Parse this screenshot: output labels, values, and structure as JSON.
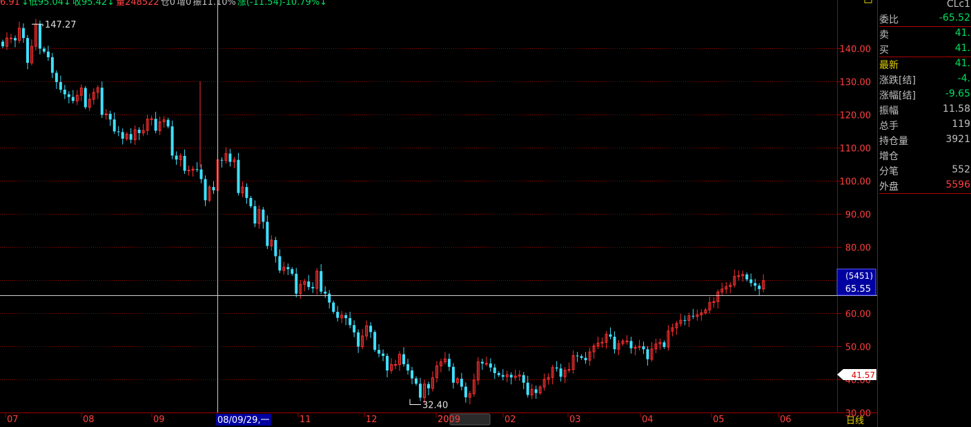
{
  "header": {
    "segments": [
      {
        "text": "6.91",
        "color": "#ff4040"
      },
      {
        "text": "↓低95.04↓",
        "color": "#00e060"
      },
      {
        "text": "收95.42↓",
        "color": "#00e060"
      },
      {
        "text": "量248522",
        "color": "#ff4040"
      },
      {
        "text": "仓0",
        "color": "#c0c0c0"
      },
      {
        "text": "增0",
        "color": "#c0c0c0"
      },
      {
        "text": "振11.10%",
        "color": "#c0c0c0"
      },
      {
        "text": "涨(-11.54)-10.79%↓",
        "color": "#00e060"
      }
    ]
  },
  "crosshair": {
    "date_label": "08/09/29,一",
    "price_value": "65.55",
    "price_extra": "(5451)"
  },
  "last_price_tag": "41.57",
  "timeframe_label": "日线",
  "annotations": {
    "high_label": "147.27",
    "low_label": "32.40"
  },
  "colors": {
    "up": "#ff3030",
    "down": "#40e0ff",
    "grid": "#a00000",
    "axis_text": "#ff4040",
    "month_text": "#ff4040"
  },
  "quote_panel": {
    "title": "CLc1",
    "rows": [
      {
        "label": "委比",
        "value": "-65.52",
        "value_color": "#00e060"
      },
      {
        "label": "卖",
        "value": "41.",
        "value_color": "#00e060"
      },
      {
        "label": "买",
        "value": "41.",
        "value_color": "#00e060"
      },
      {
        "label": "最新",
        "value": "41.",
        "value_color": "#00e060",
        "label_color": "#e6d200"
      },
      {
        "label": "涨跌[结]",
        "value": "-4.",
        "value_color": "#00e060"
      },
      {
        "label": "涨幅[结]",
        "value": "-9.65",
        "value_color": "#00e060"
      },
      {
        "label": "振幅",
        "value": "11.58",
        "value_color": "#c0c0c0"
      },
      {
        "label": "总手",
        "value": "119",
        "value_color": "#c0c0c0"
      },
      {
        "label": "持仓量",
        "value": "3921",
        "value_color": "#c0c0c0"
      },
      {
        "label": "增仓",
        "value": "",
        "value_color": "#c0c0c0"
      },
      {
        "label": "分笔",
        "value": "552",
        "value_color": "#c0c0c0"
      },
      {
        "label": "外盘",
        "value": "5596",
        "value_color": "#ff4040"
      }
    ]
  },
  "chart_data": {
    "type": "candlestick",
    "y_ticks": [
      30,
      40,
      50,
      60,
      70,
      80,
      90,
      100,
      110,
      120,
      130,
      140
    ],
    "y_tick_labels": [
      "30.00",
      "40.00",
      "50.00",
      "60.00",
      "70.00",
      "80.00",
      "90.00",
      "100.00",
      "110.00",
      "120.00",
      "130.00",
      "140.00"
    ],
    "ylim": [
      28,
      158
    ],
    "x_labels": [
      "07",
      "08",
      "09",
      "08/09/29,一",
      "11",
      "12",
      "2009",
      "02",
      "03",
      "04",
      "05",
      "06"
    ],
    "grid": true,
    "closes": [
      140.6,
      143.1,
      143.1,
      142.4,
      146.1,
      143.1,
      135.6,
      140.6,
      147.3,
      139.9,
      139.0,
      137.3,
      132.6,
      129.8,
      127.5,
      126.1,
      125.3,
      124.1,
      125.8,
      128.0,
      122.2,
      124.6,
      126.7,
      128.1,
      119.9,
      120.2,
      118.5,
      114.9,
      114.7,
      112.7,
      114.1,
      112.4,
      115.4,
      114.4,
      115.2,
      118.6,
      118.7,
      115.1,
      117.8,
      118.4,
      116.4,
      107.6,
      106.4,
      107.5,
      103.0,
      103.2,
      103.5,
      103.4,
      100.5,
      94.1,
      98.1,
      97.1,
      106.3,
      106.1,
      108.2,
      105.7,
      106.3,
      96.3,
      98.1,
      94.8,
      92.3,
      87.1,
      91.3,
      87.6,
      80.3,
      82.1,
      77.2,
      72.9,
      73.9,
      73.3,
      71.9,
      65.9,
      68.7,
      69.6,
      67.9,
      67.5,
      72.7,
      66.5,
      65.9,
      63.2,
      60.4,
      58.6,
      59.4,
      58.5,
      56.4,
      54.2,
      49.9,
      53.1,
      56.2,
      54.3,
      48.9,
      47.8,
      47.1,
      42.7,
      44.5,
      44.5,
      47.6,
      44.6,
      42.7,
      40.3,
      38.7,
      34.5,
      38.6,
      37.3,
      40.5,
      44.1,
      45.3,
      46.2,
      43.8,
      39.0,
      40.2,
      37.8,
      34.6,
      35.7,
      39.8,
      45.3,
      44.8,
      44.8,
      43.6,
      41.9,
      41.3,
      40.8,
      41.4,
      40.6,
      41.0,
      41.3,
      39.0,
      35.3,
      37.0,
      35.9,
      37.7,
      40.0,
      40.6,
      43.6,
      43.3,
      40.8,
      42.8,
      43.0,
      47.2,
      47.0,
      46.5,
      45.8,
      48.3,
      50.1,
      51.0,
      51.2,
      53.6,
      52.9,
      49.1,
      50.8,
      51.6,
      51.6,
      49.4,
      49.7,
      50.0,
      49.1,
      46.1,
      49.2,
      50.7,
      51.2,
      49.8,
      54.6,
      55.6,
      56.9,
      57.9,
      57.8,
      59.2,
      59.0,
      59.5,
      60.1,
      61.0,
      63.2,
      63.5,
      66.4,
      67.3,
      68.0,
      68.5,
      71.1,
      71.3,
      71.7,
      70.2,
      69.1,
      68.3,
      67.3,
      69.8
    ]
  }
}
